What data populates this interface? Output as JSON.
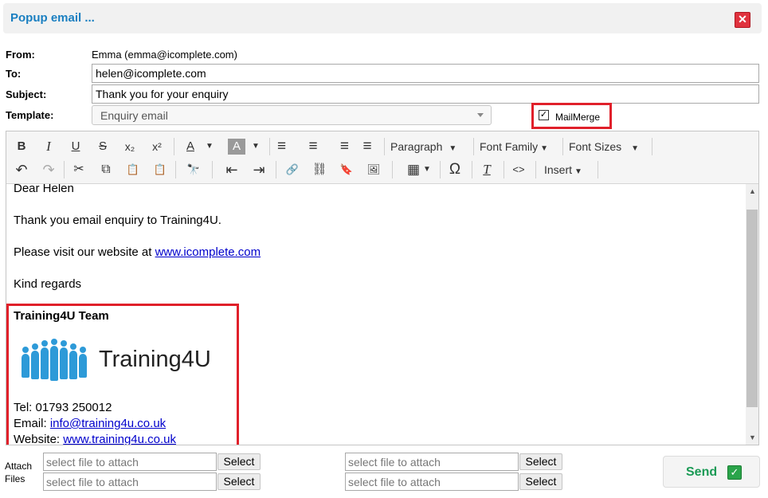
{
  "window": {
    "title": "Popup email ...",
    "close_icon": "close-icon",
    "close_glyph": "✕"
  },
  "form": {
    "from_label": "From:",
    "from_value": "Emma (emma@icomplete.com)",
    "to_label": "To:",
    "to_value": "helen@icomplete.com",
    "subject_label": "Subject:",
    "subject_value": "Thank you for your enquiry",
    "template_label": "Template:",
    "template_value": "Enquiry email",
    "mailmerge_label": "MailMerge",
    "mailmerge_checked": true,
    "mailmerge_glyph": "✓"
  },
  "toolbar": {
    "row1": [
      {
        "icon": "bold-icon",
        "glyph": "B"
      },
      {
        "icon": "italic-icon",
        "glyph": "I"
      },
      {
        "icon": "underline-icon",
        "glyph": "U"
      },
      {
        "icon": "strikethrough-icon",
        "glyph": "S"
      },
      {
        "icon": "subscript-icon",
        "glyph": "x₂"
      },
      {
        "icon": "superscript-icon",
        "glyph": "x²"
      },
      {
        "icon": "text-color-icon",
        "glyph": "A"
      },
      {
        "icon": "background-color-icon",
        "glyph": "A"
      },
      {
        "icon": "align-left-icon",
        "glyph": "≡"
      },
      {
        "icon": "align-center-icon",
        "glyph": "≡"
      },
      {
        "icon": "align-right-icon",
        "glyph": "≡"
      },
      {
        "icon": "align-justify-icon",
        "glyph": "≡"
      }
    ],
    "paragraph_label": "Paragraph",
    "font_family_label": "Font Family",
    "font_sizes_label": "Font Sizes",
    "row2": [
      {
        "icon": "undo-icon",
        "glyph": "↶"
      },
      {
        "icon": "redo-icon",
        "glyph": "↷"
      },
      {
        "icon": "cut-icon",
        "glyph": "✂"
      },
      {
        "icon": "copy-icon",
        "glyph": "⧉"
      },
      {
        "icon": "paste-icon",
        "glyph": "📋"
      },
      {
        "icon": "paste-text-icon",
        "glyph": "📋"
      },
      {
        "icon": "find-replace-icon",
        "glyph": "🔭"
      },
      {
        "icon": "outdent-icon",
        "glyph": "⇤"
      },
      {
        "icon": "indent-icon",
        "glyph": "⇥"
      },
      {
        "icon": "link-icon",
        "glyph": "🔗"
      },
      {
        "icon": "unlink-icon",
        "glyph": "⛓"
      },
      {
        "icon": "bookmark-icon",
        "glyph": "🔖"
      },
      {
        "icon": "image-icon",
        "glyph": "🖼"
      },
      {
        "icon": "table-icon",
        "glyph": "▦"
      },
      {
        "icon": "special-character-icon",
        "glyph": "Ω"
      },
      {
        "icon": "clear-formatting-icon",
        "glyph": "T"
      },
      {
        "icon": "source-code-icon",
        "glyph": "<>"
      }
    ],
    "insert_label": "Insert"
  },
  "body": {
    "greeting": "Dear Helen",
    "line1": "Thank you email enquiry to Training4U.",
    "line2_text": "Please visit our website at ",
    "line2_link": "www.icomplete.com",
    "closing": "Kind regards",
    "team": "Training4U Team",
    "logo_text": "Training4U",
    "tel": "Tel: 01793 250012",
    "email_label": "Email: ",
    "email_link": "info@training4u.co.uk",
    "website_label": "Website: ",
    "website_link": "www.training4u.co.uk"
  },
  "attach": {
    "label_line1": "Attach",
    "label_line2": "Files",
    "placeholder": "select file to attach",
    "select_label": "Select"
  },
  "send": {
    "label": "Send",
    "icon": "send-check-icon",
    "glyph": "✓"
  },
  "colors": {
    "title": "#1a7fc1",
    "highlight": "#e0202a",
    "send": "#1a9a55",
    "link": "#0000cc"
  }
}
